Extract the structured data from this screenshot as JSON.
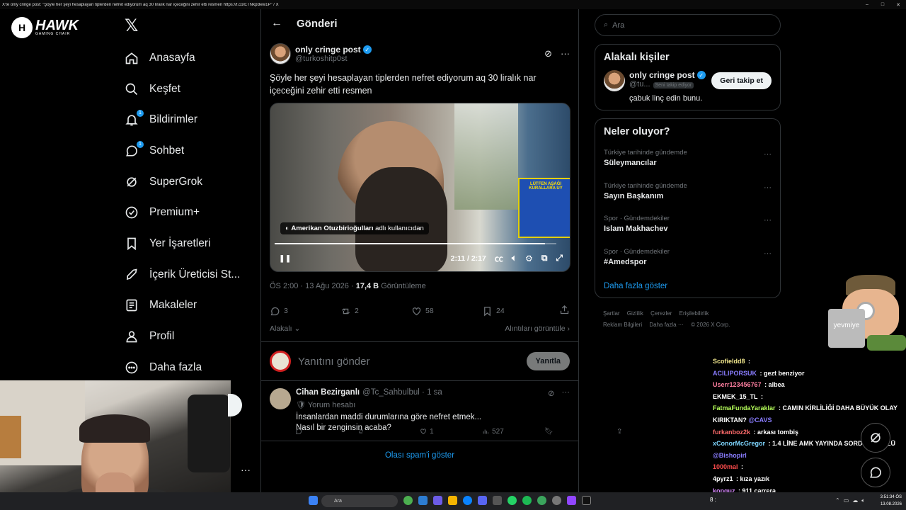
{
  "titlebar": {
    "title": "X'te only cringe post: \"Şöyle her şeyi hesaplayan tiplerden nefret ediyorum aq 30 liralık nar içeceğini zehir etti resmen https://t.co/ETNkpBew1P\" / X"
  },
  "brand": {
    "logo_letter": "H",
    "name": "HAWK",
    "tagline": "GAMING CHAIR"
  },
  "nav": {
    "items": [
      {
        "label": "Anasayfa",
        "icon": "home-icon"
      },
      {
        "label": "Keşfet",
        "icon": "search-icon"
      },
      {
        "label": "Bildirimler",
        "icon": "bell-icon",
        "badge": "1"
      },
      {
        "label": "Sohbet",
        "icon": "chat-icon",
        "badge": "1"
      },
      {
        "label": "SuperGrok",
        "icon": "grok-icon"
      },
      {
        "label": "Premium+",
        "icon": "verified-icon"
      },
      {
        "label": "Yer İşaretleri",
        "icon": "bookmark-icon"
      },
      {
        "label": "İçerik Üreticisi St...",
        "icon": "rocket-icon"
      },
      {
        "label": "Makaleler",
        "icon": "article-icon"
      },
      {
        "label": "Profil",
        "icon": "person-icon"
      },
      {
        "label": "Daha fazla",
        "icon": "more-circle-icon"
      }
    ]
  },
  "header": {
    "title": "Gönderi",
    "back": "←"
  },
  "post": {
    "display_name": "only cringe post",
    "handle": "@turkoshitp0st",
    "text": "Şöyle her şeyi hesaplayan tiplerden nefret ediyorum aq 30 liralık nar içeceğini zehir etti resmen",
    "video": {
      "caption_user": "Amerikan Otuzbirioğulları",
      "caption_suffix": "adlı kullanıcıdan",
      "time": "2:11 / 2:17",
      "progress_fraction": 0.96,
      "sign_text": "LÜTFEN AŞAĞI KURALLARA UY"
    },
    "meta_time": "ÖS 2:00 · 13 Ağu 2026 · ",
    "views": "17,4 B",
    "views_label": "Görüntüleme",
    "replies": "3",
    "reposts": "2",
    "likes": "58",
    "bookmarks": "24",
    "related": "Alakalı",
    "quotes": "Alıntıları görüntüle"
  },
  "reply_box": {
    "placeholder": "Yanıtını gönder",
    "button": "Yanıtla"
  },
  "comment": {
    "display_name": "Cihan Bezirganlı",
    "handle": "@Tc_Sahbulbul",
    "time": "· 1 sa",
    "tag": "Yorum hesabı",
    "line1": "İnsanlardan maddi durumlarına göre nefret etmek...",
    "line2": "Nasıl bir zenginsin acaba?",
    "replies": "",
    "reposts": "",
    "likes": "1",
    "views": "527"
  },
  "spam_link": "Olası spam'i göster",
  "right": {
    "search_placeholder": "Ara",
    "related_title": "Alakalı kişiler",
    "person": {
      "name": "only cringe post",
      "handle": "@tu...",
      "follows_you": "Seni takip ediyor",
      "button": "Geri takip et",
      "bio": "çabuk linç edin bunu."
    },
    "trends_title": "Neler oluyor?",
    "trends": [
      {
        "context": "Türkiye tarihinde gündemde",
        "name": "Süleymancılar"
      },
      {
        "context": "Türkiye tarihinde gündemde",
        "name": "Sayın Başkanım"
      },
      {
        "context": "Spor · Gündemdekiler",
        "name": "Islam Makhachev"
      },
      {
        "context": "Spor · Gündemdekiler",
        "name": "#Amedspor"
      }
    ],
    "show_more": "Daha fazla göster",
    "footer1": [
      "Şartlar",
      "Gizlilik",
      "Çerezler",
      "Erişilebilirlik"
    ],
    "footer2": [
      "Reklam Bilgileri",
      "Daha fazla ···",
      "© 2026 X Corp."
    ]
  },
  "overlay": {
    "mascot_label": "yevmiye"
  },
  "chat": [
    {
      "user": "Scofieldd8",
      "color": "#f0e68c",
      "msg": ""
    },
    {
      "user": "ACILIPORSUK",
      "color": "#8a7dff",
      "msg": "gezt benziyor"
    },
    {
      "user": "Userr123456767",
      "color": "#ff7fa0",
      "msg": "albea"
    },
    {
      "user": "EKMEK_15_TL",
      "color": "#ffffff",
      "msg": ""
    },
    {
      "user": "FatmaFundaYaraklar",
      "color": "#b6ff5a",
      "msg": "CAMIN KİRLİLİĞİ DAHA BÜYÜK OLAY KIRIKTAN?",
      "mention": "@CAVS"
    },
    {
      "user": "furkanboz2k",
      "color": "#ff6b6b",
      "msg": "arkası tombiş"
    },
    {
      "user": "xConorMcGregor",
      "color": "#7fd6ff",
      "msg": "1.4 LİNE AMK YAYINDA SORDUM TÜPLÜ",
      "mention": "@Bishopirl"
    },
    {
      "user": "1000mal",
      "color": "#ff4d4d",
      "msg": ""
    },
    {
      "user": "4pyrz1",
      "color": "#ffffff",
      "msg": "kıza yazık"
    },
    {
      "user": "kopguz",
      "color": "#d88bff",
      "msg": "911 carrera"
    }
  ],
  "taskbar": {
    "search": "Ara",
    "time": "3:51:34 ÖS",
    "date": "13.08.2026",
    "left": "8 :"
  }
}
